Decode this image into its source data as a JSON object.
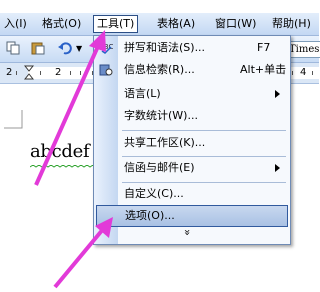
{
  "menubar": {
    "items": [
      {
        "label": "入(I)"
      },
      {
        "label": "格式(O)"
      },
      {
        "label": "工具(T)"
      },
      {
        "label": "表格(A)"
      },
      {
        "label": "窗口(W)"
      },
      {
        "label": "帮助(H)"
      }
    ]
  },
  "toolbar": {
    "font_name": "Times"
  },
  "ruler": {
    "marks": [
      "2",
      "2",
      "4"
    ]
  },
  "document": {
    "text": "abcdef"
  },
  "tools_menu": {
    "items": [
      {
        "label": "拼写和语法(S)...",
        "shortcut": "F7"
      },
      {
        "label": "信息检索(R)...",
        "shortcut": "Alt+单击"
      },
      {
        "label": "语言(L)",
        "submenu": true
      },
      {
        "label": "字数统计(W)..."
      },
      {
        "label": "共享工作区(K)..."
      },
      {
        "label": "信函与邮件(E)",
        "submenu": true
      },
      {
        "label": "自定义(C)..."
      },
      {
        "label": "选项(O)...",
        "highlighted": true
      }
    ],
    "expand_glyph": "»"
  },
  "colors": {
    "arrow": "#e23ad8",
    "highlight_border": "#315a9e",
    "menubar": "#c3d8f3"
  }
}
